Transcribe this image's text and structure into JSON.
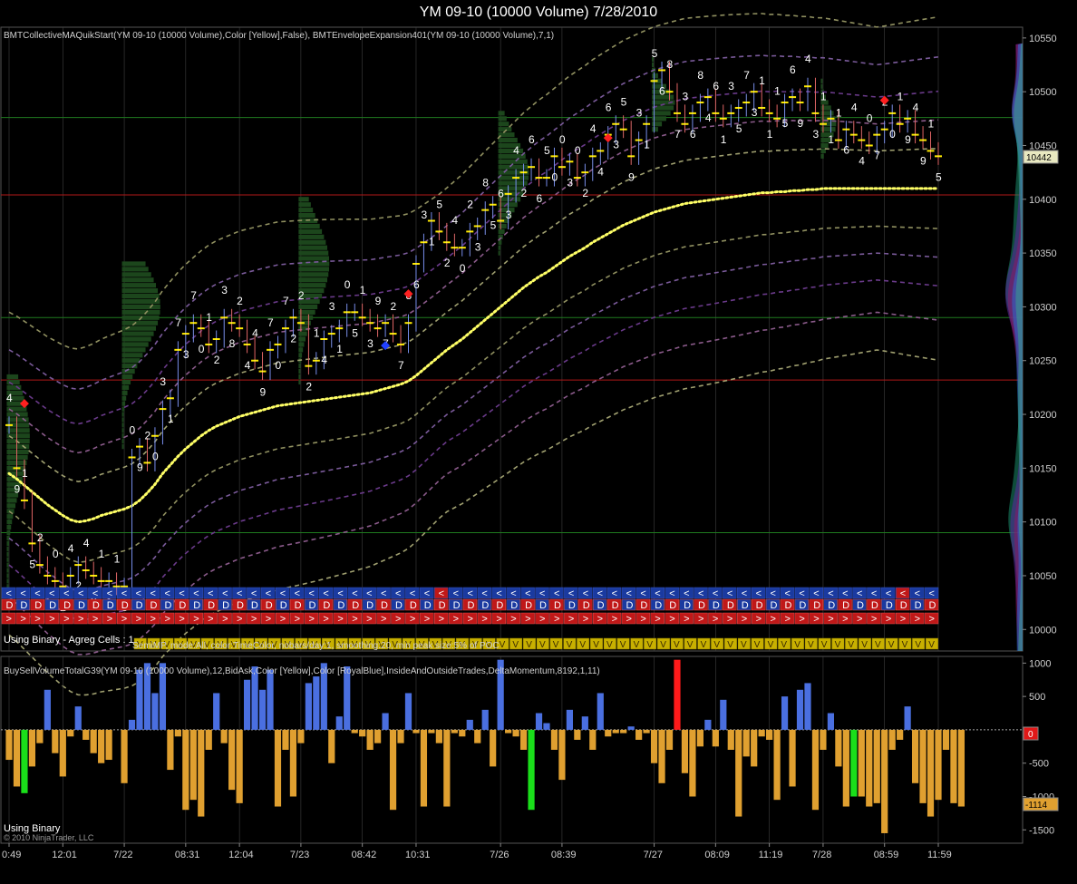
{
  "window": {
    "title": "YM 09-10 (10000 Volume)  7/28/2010"
  },
  "upper": {
    "indicator_label": "BMTCollectiveMAQuikStart(YM 09-10 (10000 Volume),Color [Yellow],False), BMTEnvelopeExpansion401(YM 09-10 (10000 Volume),7,1)",
    "binary_label": "Using Binary - Agreg Cells : 1",
    "tpo_label": "SemiMP, mode:All, color:TimeColor, nobars/day:1, smoothing:20, min peak size:5% of POC",
    "last_price": "10442"
  },
  "lower": {
    "indicator_label": "BuySellVolumeTotalG39(YM 09-10 (10000 Volume),12,BidAsk,Color [Yellow],Color [RoyalBlue],InsideAndOutsideTrades,DeltaMomentum,8192,1,11)",
    "binary_label": "Using Binary",
    "copyright": "© 2010 NinjaTrader, LLC",
    "zero_label": "0",
    "last_value": "-1114"
  },
  "x_axis": {
    "ticks": [
      {
        "label": "0:49",
        "i": 0
      },
      {
        "label": "12:01",
        "i": 7
      },
      {
        "label": "7/22",
        "i": 15
      },
      {
        "label": "08:31",
        "i": 23
      },
      {
        "label": "12:04",
        "i": 30
      },
      {
        "label": "7/23",
        "i": 38
      },
      {
        "label": "08:42",
        "i": 46
      },
      {
        "label": "10:31",
        "i": 53
      },
      {
        "label": "7/26",
        "i": 64
      },
      {
        "label": "08:39",
        "i": 72
      },
      {
        "label": "7/27",
        "i": 84
      },
      {
        "label": "08:09",
        "i": 92
      },
      {
        "label": "11:19",
        "i": 99
      },
      {
        "label": "7/28",
        "i": 106
      },
      {
        "label": "08:59",
        "i": 114
      },
      {
        "label": "11:59",
        "i": 121
      }
    ]
  },
  "colors": {
    "buy": "#4a6fe0",
    "sell": "#e0a030",
    "buy_strong": "#ff1a1a",
    "sell_strong": "#1adf1a",
    "ema": "#ffff66",
    "envelope": "#c0c080",
    "grid": "#404040",
    "green_line": "#1f7a1f",
    "red_line": "#b01818"
  },
  "chart_data": [
    {
      "type": "line",
      "name": "price",
      "ylim": [
        9980,
        10560
      ],
      "y_ticks": [
        10000,
        10050,
        10100,
        10150,
        10200,
        10250,
        10300,
        10350,
        10400,
        10450,
        10500,
        10550
      ],
      "horizontal_lines": [
        {
          "value": 10476,
          "color": "green"
        },
        {
          "value": 10404,
          "color": "red"
        },
        {
          "value": 10290,
          "color": "green"
        },
        {
          "value": 10232,
          "color": "red"
        },
        {
          "value": 10090,
          "color": "green"
        }
      ],
      "close": [
        10190,
        10150,
        10120,
        10080,
        10060,
        10050,
        10045,
        10040,
        10050,
        10060,
        10055,
        10050,
        10045,
        10045,
        10040,
        10040,
        10160,
        10170,
        10155,
        10180,
        10205,
        10215,
        10260,
        10275,
        10285,
        10280,
        10265,
        10270,
        10290,
        10285,
        10280,
        10265,
        10250,
        10240,
        10260,
        10265,
        10280,
        10290,
        10285,
        10245,
        10250,
        10270,
        10275,
        10280,
        10295,
        10295,
        10290,
        10285,
        10280,
        10285,
        10275,
        10265,
        10285,
        10340,
        10360,
        10380,
        10370,
        10360,
        10355,
        10355,
        10370,
        10375,
        10390,
        10395,
        10380,
        10405,
        10420,
        10425,
        10430,
        10420,
        10420,
        10440,
        10430,
        10435,
        10420,
        10425,
        10440,
        10445,
        10460,
        10470,
        10465,
        10440,
        10455,
        10470,
        10510,
        10520,
        10500,
        10480,
        10470,
        10480,
        10490,
        10495,
        10480,
        10475,
        10480,
        10485,
        10490,
        10500,
        10485,
        10480,
        10475,
        10490,
        10495,
        10490,
        10505,
        10480,
        10470,
        10475,
        10455,
        10465,
        10460,
        10455,
        10450,
        10460,
        10465,
        10480,
        10470,
        10475,
        10460,
        10455,
        10445,
        10440
      ],
      "ema": [
        10145,
        10140,
        10134,
        10128,
        10122,
        10116,
        10111,
        10106,
        10102,
        10100,
        10101,
        10103,
        10106,
        10108,
        10110,
        10112,
        10115,
        10120,
        10127,
        10135,
        10145,
        10153,
        10161,
        10168,
        10174,
        10180,
        10185,
        10189,
        10192,
        10195,
        10198,
        10200,
        10202,
        10204,
        10206,
        10208,
        10209,
        10210,
        10211,
        10212,
        10213,
        10214,
        10215,
        10216,
        10217,
        10218,
        10219,
        10220,
        10222,
        10224,
        10226,
        10228,
        10231,
        10236,
        10242,
        10248,
        10254,
        10260,
        10265,
        10270,
        10276,
        10282,
        10288,
        10294,
        10300,
        10306,
        10312,
        10318,
        10323,
        10328,
        10332,
        10337,
        10342,
        10347,
        10351,
        10355,
        10360,
        10364,
        10368,
        10372,
        10376,
        10379,
        10382,
        10385,
        10388,
        10390,
        10392,
        10394,
        10396,
        10397,
        10398,
        10399,
        10400,
        10401,
        10402,
        10403,
        10404,
        10405,
        10406,
        10406,
        10407,
        10407,
        10408,
        10408,
        10409,
        10409,
        10410,
        10410,
        10410,
        10410,
        10410,
        10410,
        10410,
        10410,
        10410,
        10410,
        10410,
        10410,
        10410,
        10410,
        10410,
        10410
      ],
      "envelope_offsets": [
        -150,
        -115,
        -85,
        -60,
        -35,
        35,
        60,
        85,
        115,
        150
      ],
      "cell_digits": "4915210242451113092031737012382449707222143105139727863152402385634266500302446359315687368461357311156943111644072019",
      "markers": [
        {
          "i": 2,
          "value": 10210,
          "color": "red"
        },
        {
          "i": 52,
          "value": 10312,
          "color": "red"
        },
        {
          "i": 49,
          "value": 10264,
          "color": "blue"
        },
        {
          "i": 78,
          "value": 10457,
          "color": "red"
        },
        {
          "i": 114,
          "value": 10492,
          "color": "red"
        }
      ],
      "volume_profile": [
        {
          "start": 0,
          "poc": 10180,
          "range": [
            10040,
            10235
          ],
          "width": 3
        },
        {
          "start": 15,
          "poc": 10300,
          "range": [
            10170,
            10340
          ],
          "width": 5
        },
        {
          "start": 38,
          "poc": 10340,
          "range": [
            10230,
            10400
          ],
          "width": 4
        },
        {
          "start": 64,
          "poc": 10425,
          "range": [
            10350,
            10480
          ],
          "width": 4
        },
        {
          "start": 84,
          "poc": 10490,
          "range": [
            10465,
            10530
          ],
          "width": 3
        },
        {
          "start": 106,
          "poc": 10470,
          "range": [
            10440,
            10510
          ],
          "width": 2
        }
      ]
    },
    {
      "type": "bar",
      "name": "delta",
      "ylim": [
        -1700,
        1100
      ],
      "y_ticks": [
        1000,
        500,
        0,
        -500,
        -1000,
        -1500
      ],
      "values": [
        -450,
        -850,
        -950,
        -550,
        -200,
        600,
        -350,
        -700,
        -100,
        350,
        -150,
        -350,
        -500,
        -450,
        0,
        -800,
        150,
        900,
        1000,
        550,
        1000,
        -600,
        -100,
        -1200,
        -1050,
        -1300,
        -300,
        550,
        -200,
        -900,
        -1100,
        750,
        950,
        600,
        900,
        -1150,
        -300,
        -1000,
        -200,
        700,
        800,
        1000,
        -500,
        200,
        950,
        -50,
        -100,
        -300,
        -200,
        250,
        -1200,
        -200,
        550,
        -50,
        -1150,
        -50,
        -200,
        -1150,
        -50,
        -100,
        150,
        -200,
        300,
        -550,
        1050,
        -50,
        -100,
        -300,
        -1200,
        250,
        100,
        -300,
        -750,
        300,
        -150,
        200,
        -300,
        550,
        -100,
        -50,
        -50,
        50,
        -150,
        -50,
        -500,
        -800,
        -300,
        1050,
        -650,
        -1000,
        -250,
        150,
        -250,
        450,
        -300,
        -1300,
        -400,
        -550,
        -100,
        -150,
        -1050,
        500,
        -850,
        600,
        700,
        -1200,
        -300,
        250,
        -550,
        -1150,
        -1000,
        -1000,
        -1150,
        -1100,
        -1550,
        -300,
        -150,
        350,
        -800,
        -1100,
        -1300,
        -1050,
        -300,
        -1100,
        -1150
      ],
      "strong": [
        2,
        35,
        36,
        37,
        38,
        39,
        40,
        41,
        42,
        43,
        44,
        60,
        61,
        62,
        63,
        64,
        65,
        66,
        67,
        68,
        69,
        70,
        71,
        72,
        73,
        74,
        75,
        76,
        77,
        78,
        79,
        80,
        81,
        82,
        83,
        84,
        85,
        86,
        87,
        88,
        89,
        90,
        91,
        92,
        93,
        94,
        95,
        96,
        97,
        98,
        99,
        100,
        101,
        102,
        103,
        104,
        105,
        106,
        107,
        108,
        109,
        110,
        111,
        112,
        113,
        114,
        115,
        116,
        117,
        118,
        119,
        120,
        121
      ]
    }
  ]
}
